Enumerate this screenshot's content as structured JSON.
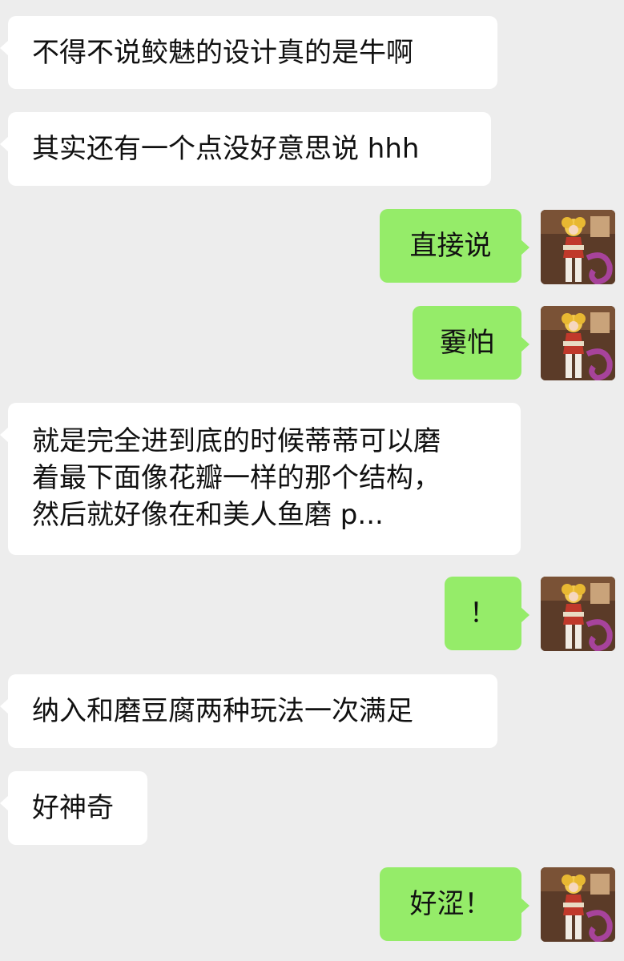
{
  "messages": [
    {
      "side": "in",
      "lines": [
        "不得不说鲛魅的设计真的是牛啊"
      ]
    },
    {
      "side": "in",
      "lines": [
        "其实还有一个点没好意思说 hhh"
      ]
    },
    {
      "side": "out",
      "lines": [
        "直接说"
      ],
      "avatar_icon": "character-avatar-icon"
    },
    {
      "side": "out",
      "lines": [
        "嫑怕"
      ],
      "avatar_icon": "character-avatar-icon"
    },
    {
      "side": "in",
      "lines": [
        "就是完全进到底的时候蒂蒂可以磨",
        "着最下面像花瓣一样的那个结构，",
        "然后就好像在和美人鱼磨 p..."
      ]
    },
    {
      "side": "out",
      "lines": [
        "！"
      ],
      "avatar_icon": "character-avatar-icon"
    },
    {
      "side": "in",
      "lines": [
        "纳入和磨豆腐两种玩法一次满足"
      ]
    },
    {
      "side": "in",
      "lines": [
        "好神奇"
      ]
    },
    {
      "side": "out",
      "lines": [
        "好涩！"
      ],
      "avatar_icon": "character-avatar-icon"
    }
  ],
  "colors": {
    "background": "#ededed",
    "incoming_bubble": "#ffffff",
    "outgoing_bubble": "#95ec69",
    "text": "#111111"
  }
}
